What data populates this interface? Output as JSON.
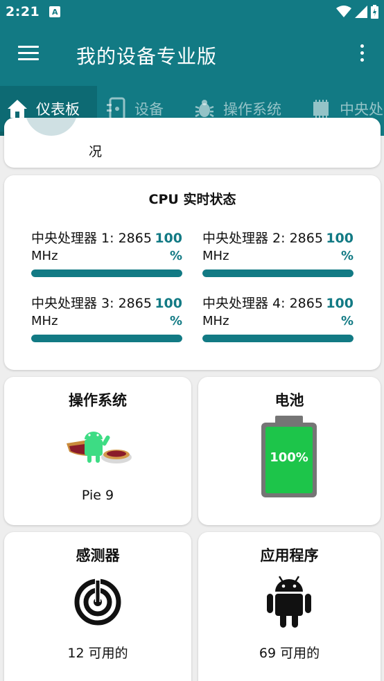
{
  "status_bar": {
    "time": "2:21",
    "app_icon_letter": "A"
  },
  "app_bar": {
    "title": "我的设备专业版"
  },
  "tabs": [
    {
      "label": "仪表板",
      "icon": "home-icon",
      "active": true
    },
    {
      "label": "设备",
      "icon": "device-icon",
      "active": false
    },
    {
      "label": "操作系统",
      "icon": "bug-icon",
      "active": false
    },
    {
      "label": "中央处",
      "icon": "chip-icon",
      "active": false
    }
  ],
  "partial_card": {
    "text": "况"
  },
  "cpu_card": {
    "title": "CPU 实时状态",
    "items": [
      {
        "label": "中央处理器 1: 2865",
        "unit": "MHz",
        "percent": "100",
        "percent_sign": "%",
        "load": 1.0
      },
      {
        "label": "中央处理器 2: 2865",
        "unit": "MHz",
        "percent": "100",
        "percent_sign": "%",
        "load": 1.0
      },
      {
        "label": "中央处理器 3: 2865",
        "unit": "MHz",
        "percent": "100",
        "percent_sign": "%",
        "load": 1.0
      },
      {
        "label": "中央处理器 4: 2865",
        "unit": "MHz",
        "percent": "100",
        "percent_sign": "%",
        "load": 1.0
      }
    ]
  },
  "os_card": {
    "title": "操作系统",
    "value": "Pie 9",
    "icon": "android-pie-icon"
  },
  "battery_card": {
    "title": "电池",
    "level_text": "100%",
    "level": 1.0,
    "fill_color": "#1dc54a",
    "icon": "battery-icon"
  },
  "sensor_card": {
    "title": "感测器",
    "value": "12 可用的",
    "icon": "radar-icon"
  },
  "apps_card": {
    "title": "应用程序",
    "value": "69 可用的",
    "icon": "android-icon"
  },
  "colors": {
    "primary": "#127a84",
    "accent_bar": "#127a84"
  }
}
